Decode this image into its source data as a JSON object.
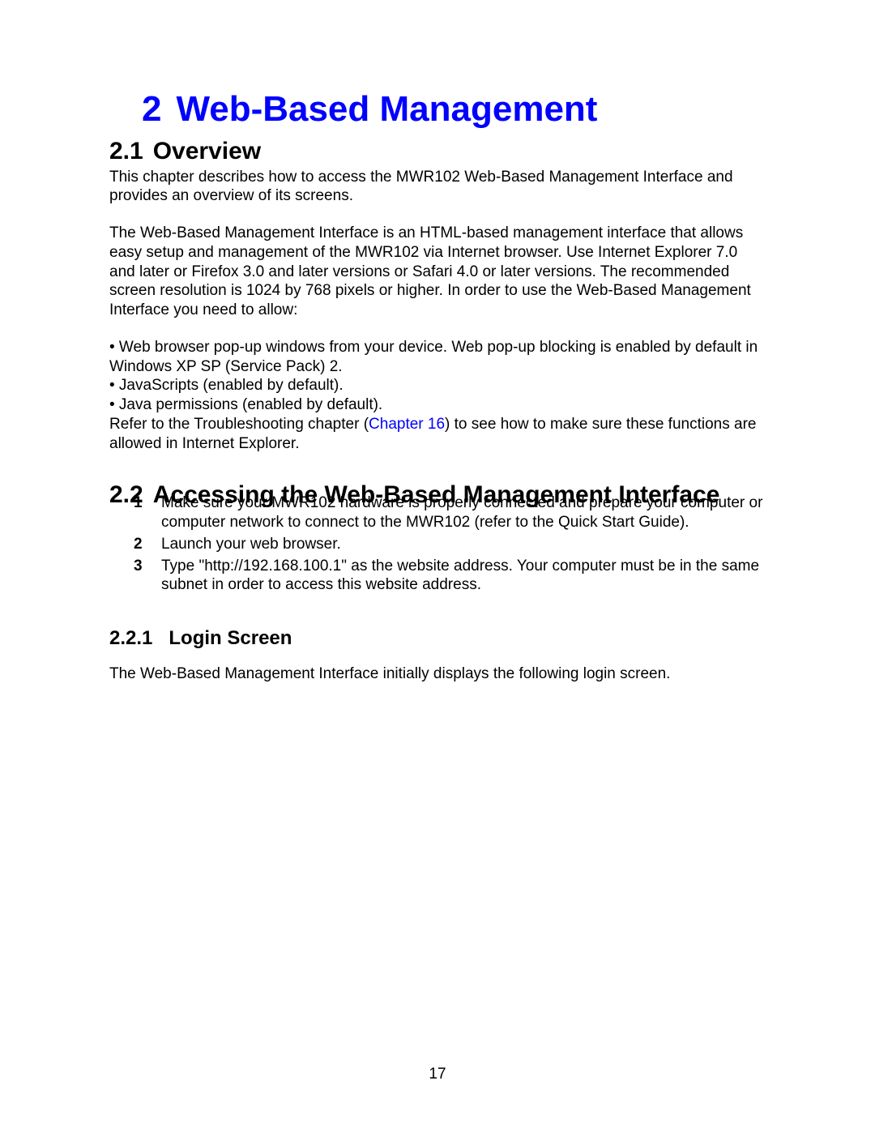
{
  "chapter": {
    "number": "2",
    "title": "Web-Based Management"
  },
  "section_2_1": {
    "number": "2.1",
    "title": "Overview",
    "para1": "This chapter describes how to access the MWR102 Web-Based Management Interface and provides an overview of its screens.",
    "para2": "The Web-Based Management Interface is an HTML-based management interface that allows easy setup and management of the MWR102 via Internet browser. Use Internet Explorer 7.0 and later or Firefox 3.0 and later versions or Safari 4.0 or later versions. The recommended screen resolution is 1024 by 768 pixels or higher. In order to use the Web-Based Management Interface you need to allow:",
    "bullets": [
      "• Web browser pop-up windows from your device. Web pop-up blocking is enabled by default in Windows XP SP (Service Pack) 2.",
      "• JavaScripts (enabled by default).",
      "• Java permissions (enabled by default)."
    ],
    "after_bullets_pre": "Refer to the Troubleshooting chapter (",
    "xref": "Chapter 16",
    "after_bullets_post": ") to see how to make sure these functions are allowed in Internet Explorer."
  },
  "section_2_2": {
    "number": "2.2",
    "title": "Accessing the Web-Based Management Interface",
    "steps": [
      {
        "n": "1",
        "text": "Make sure your MWR102 hardware is properly connected and prepare your computer or computer network to connect to the MWR102 (refer to the Quick Start Guide)."
      },
      {
        "n": "2",
        "text": "Launch your web browser."
      },
      {
        "n": "3",
        "text": "Type \"http://192.168.100.1\" as the website address. Your computer must be in the same subnet in order to access this website address."
      }
    ]
  },
  "section_2_2_1": {
    "number": "2.2.1",
    "title": "Login Screen",
    "para": "The Web-Based Management Interface initially displays the following login screen."
  },
  "page_number": "17"
}
